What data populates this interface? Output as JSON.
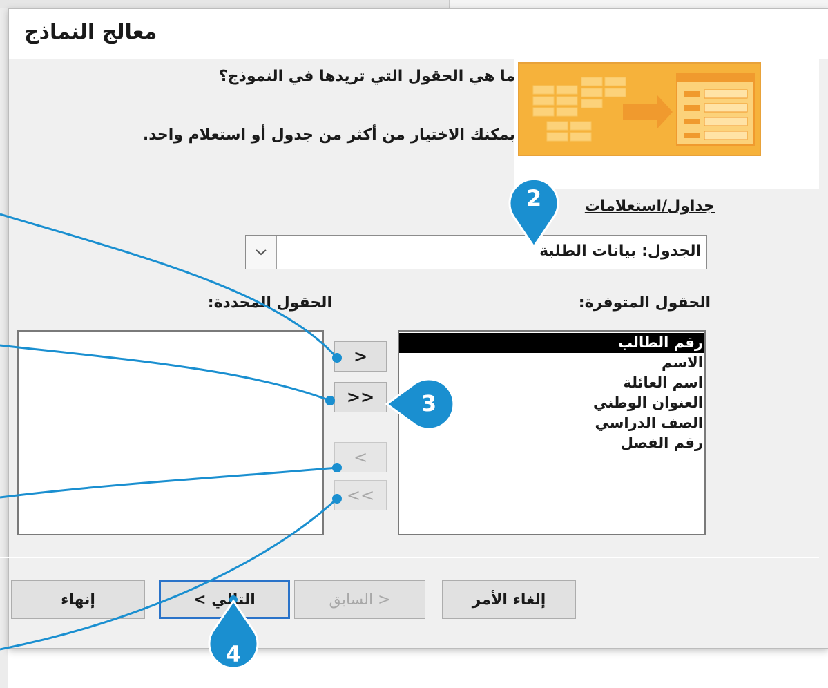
{
  "dialog": {
    "title": "معالج النماذج",
    "question": "ما هي الحقول التي تريدها في النموذج؟",
    "hint": "بمكنك الاختيار من أكثر من جدول أو استعلام واحد."
  },
  "tables_label": "جداول/استعلامات",
  "table_combo": {
    "value": "الجدول: بيانات الطلبة"
  },
  "available_label": "الحقول المتوفرة:",
  "selected_label": "الحقول المحددة:",
  "available_fields": [
    "رقم الطالب",
    "الاسم",
    "اسم العائلة",
    "العنوان الوطني",
    "الصف الدراسي",
    "رقم الفصل"
  ],
  "selected_fields": [],
  "move_buttons": {
    "add_one": ">",
    "add_all": ">>",
    "remove_one": "<",
    "remove_all": "<<"
  },
  "buttons": {
    "cancel": "إلغاء الأمر",
    "back": "< السابق",
    "next": "التالي >",
    "finish": "إنهاء"
  },
  "callouts": [
    "2",
    "3",
    "4"
  ],
  "colors": {
    "callout": "#1a8fd0",
    "banner": "#f6b23b",
    "selection": "#000000",
    "focus_border": "#2a73c9"
  }
}
